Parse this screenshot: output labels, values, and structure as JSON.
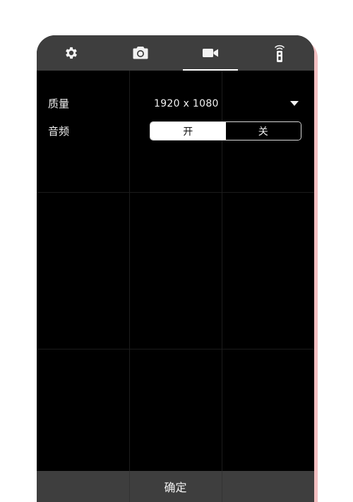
{
  "tabs": [
    {
      "icon": "gear-icon",
      "active": false
    },
    {
      "icon": "camera-icon",
      "active": false
    },
    {
      "icon": "video-camera-icon",
      "active": true
    },
    {
      "icon": "remote-control-icon",
      "active": false
    }
  ],
  "settings": {
    "quality": {
      "label": "质量",
      "value": "1920  x 1080"
    },
    "audio": {
      "label": "音频",
      "on_label": "开",
      "off_label": "关",
      "selected": "on"
    }
  },
  "footer": {
    "confirm_label": "确定"
  },
  "colors": {
    "bar": "#3e3e3e",
    "background": "#000000",
    "text": "#f2f2f2",
    "accent_edge": "#e98a8e"
  }
}
